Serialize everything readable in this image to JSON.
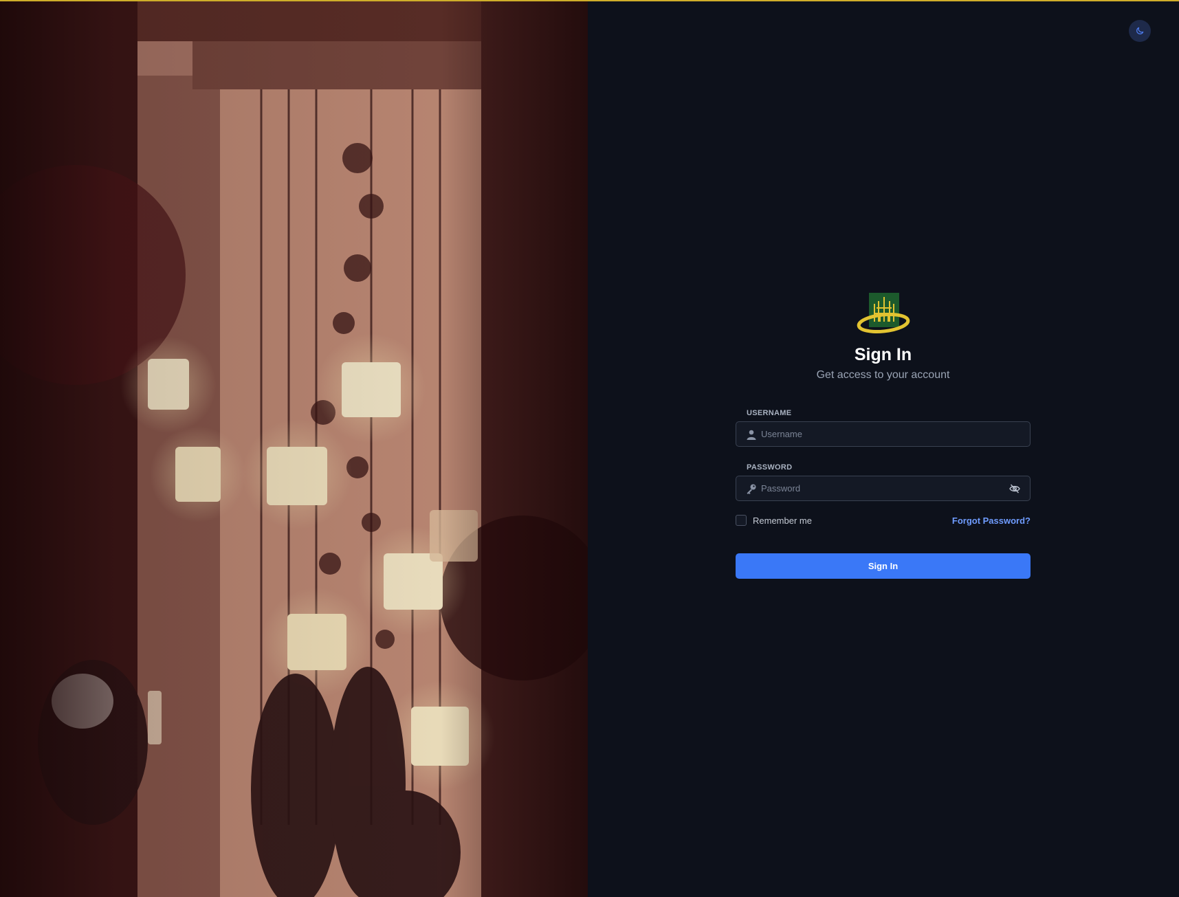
{
  "theme_toggle": {
    "icon": "moon-icon"
  },
  "logo": {
    "icon": "castle-emblem-logo"
  },
  "header": {
    "title": "Sign In",
    "subtitle": "Get access to your account"
  },
  "username": {
    "label": "USERNAME",
    "placeholder": "Username",
    "value": "",
    "icon": "user-icon"
  },
  "password": {
    "label": "PASSWORD",
    "placeholder": "Password",
    "value": "",
    "icon": "key-icon",
    "toggle_icon": "eye-off-icon"
  },
  "remember": {
    "label": "Remember me",
    "checked": false
  },
  "forgot_link": "Forgot Password?",
  "submit_label": "Sign In",
  "colors": {
    "background": "#0d111b",
    "accent": "#3a78f7",
    "link": "#6f9cff",
    "top_border": "#cfae2a"
  }
}
